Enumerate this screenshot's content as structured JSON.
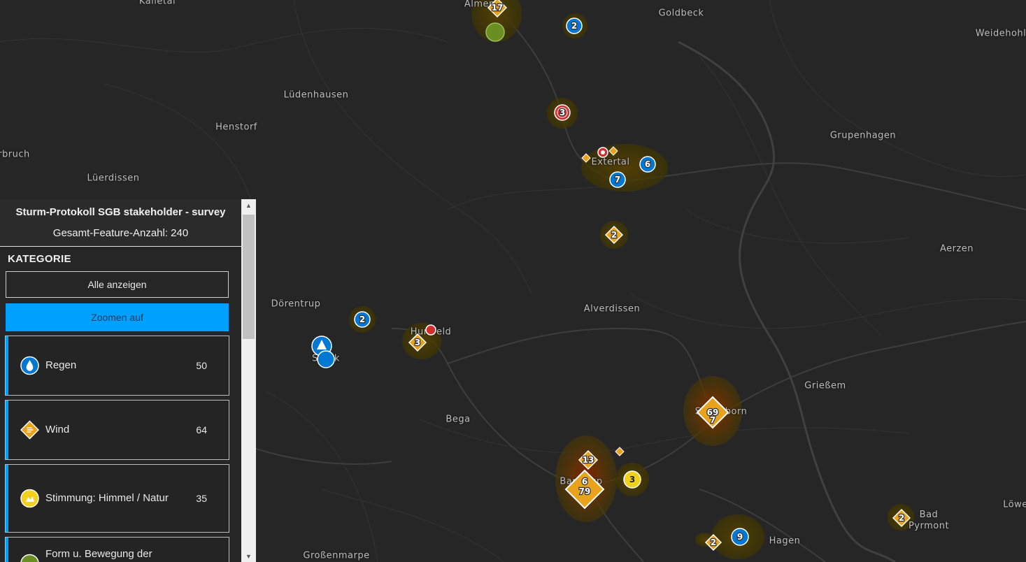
{
  "map": {
    "places": [
      {
        "name": "Kalletal"
      },
      {
        "name": "Almena"
      },
      {
        "name": "Goldbeck"
      },
      {
        "name": "Weidehohl"
      },
      {
        "name": "Lüdenhausen"
      },
      {
        "name": "Henstorf"
      },
      {
        "name": "rbruch"
      },
      {
        "name": "Lüerdissen"
      },
      {
        "name": "Grupenhagen"
      },
      {
        "name": "Extertal"
      },
      {
        "name": "Aerzen"
      },
      {
        "name": "Dörentrup"
      },
      {
        "name": "Alverdissen"
      },
      {
        "name": "Humfeld"
      },
      {
        "name": "Spork"
      },
      {
        "name": "Grießem"
      },
      {
        "name": "Sonneborn"
      },
      {
        "name": "Bega"
      },
      {
        "name": "Barntrup"
      },
      {
        "name": "Bad Pyrmont"
      },
      {
        "name": "Hagen"
      },
      {
        "name": "Großenmarpe"
      },
      {
        "name": "Löwe"
      }
    ],
    "cluster_counts": [
      "17",
      "2",
      "3",
      "6",
      "7",
      "2",
      "2",
      "3",
      "69",
      "7",
      "13",
      "6",
      "79",
      "3",
      "2",
      "9",
      "2"
    ],
    "colors": {
      "rain": "#0078d4",
      "wind": "#e8a21b",
      "mood": "#f2d11c",
      "target": "#d32f2f",
      "green": "#6b8e23",
      "heat": "#5a3a00"
    }
  },
  "panel": {
    "title": "Sturm-Protokoll SGB stakeholder - survey",
    "subtitle": "Gesamt-Feature-Anzahl: 240",
    "section_label": "KATEGORIE",
    "show_all_label": "Alle anzeigen",
    "zoom_label": "Zoomen auf",
    "categories": [
      {
        "label": "Regen",
        "count": "50",
        "icon": "raindrop-icon"
      },
      {
        "label": "Wind",
        "count": "64",
        "icon": "wind-diamond-icon"
      },
      {
        "label": "Stimmung: Himmel / Natur",
        "count": "35",
        "icon": "mood-sun-icon"
      },
      {
        "label": "Form u. Bewegung der",
        "count": "",
        "icon": "form-icon"
      }
    ],
    "accent_color": "#00a0ff"
  }
}
